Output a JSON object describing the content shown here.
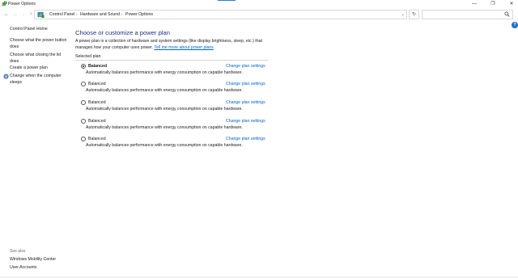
{
  "window": {
    "title": "Power Options",
    "minimize_glyph": "—",
    "maximize_glyph": "❐",
    "close_glyph": "✕"
  },
  "nav": {
    "back_glyph": "←",
    "forward_glyph": "→",
    "recent_glyph": "⌄",
    "up_glyph": "↑",
    "breadcrumbs": [
      "Control Panel",
      "Hardware and Sound",
      "Power Options"
    ],
    "separator_glyph": "›",
    "dropdown_glyph": "⌄",
    "refresh_glyph": "↻",
    "search_placeholder": ""
  },
  "help": {
    "glyph": "?"
  },
  "sidebar": {
    "links": [
      "Control Panel Home",
      "Choose what the power button does",
      "Choose what closing the lid does",
      "Create a power plan",
      "Change when the computer sleeps"
    ],
    "see_also_label": "See also",
    "see_also_links": [
      "Windows Mobility Center",
      "User Accounts"
    ]
  },
  "main": {
    "title": "Choose or customize a power plan",
    "intro_text": "A power plan is a collection of hardware and system settings (like display brightness, sleep, etc.) that manages how your computer uses power. ",
    "intro_link": "Tell me more about power plans",
    "selected_plan_label": "Selected plan",
    "plans": [
      {
        "name": "Balanced",
        "selected": true,
        "change_label": "Change plan settings",
        "description": "Automatically balances performance with energy consumption on capable hardware."
      },
      {
        "name": "Balanced",
        "selected": false,
        "change_label": "Change plan settings",
        "description": "Automatically balances performance with energy consumption on capable hardware."
      },
      {
        "name": "Balanced",
        "selected": false,
        "change_label": "Change plan settings",
        "description": "Automatically balances performance with energy consumption on capable hardware."
      },
      {
        "name": "Balanced",
        "selected": false,
        "change_label": "Change plan settings",
        "description": "Automatically balances performance with energy consumption on capable hardware."
      },
      {
        "name": "Balanced",
        "selected": false,
        "change_label": "Change plan settings",
        "description": "Automatically balances performance with energy consumption on capable hardware."
      }
    ]
  },
  "colors": {
    "title_blue": "#1e3287",
    "link_blue": "#0066cc",
    "accent_blue": "#2b7cd3"
  },
  "icons": {
    "app": "power-options-icon",
    "address": "control-panel-icon",
    "sleep_link": "shield-icon",
    "search": "search-icon"
  }
}
